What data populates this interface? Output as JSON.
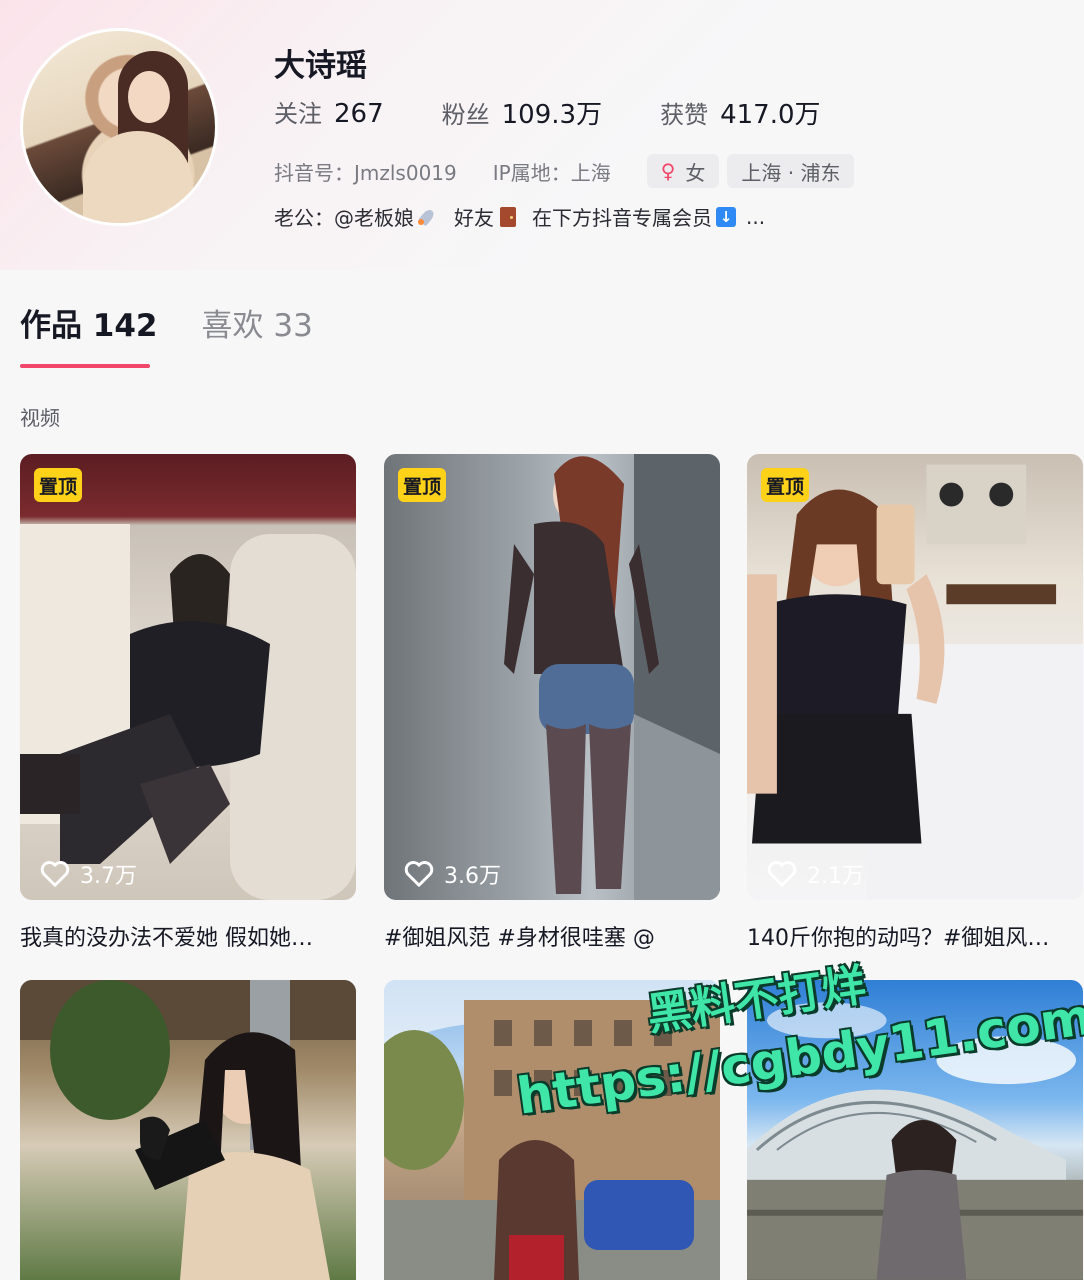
{
  "profile": {
    "name": "大诗瑶",
    "stats": [
      {
        "label": "关注",
        "value": "267"
      },
      {
        "label": "粉丝",
        "value": "109.3万"
      },
      {
        "label": "获赞",
        "value": "417.0万"
      }
    ],
    "douyin_id": "抖音号：Jmzls0019",
    "ip_location": "IP属地：上海",
    "gender_chip": "女",
    "location_chip": "上海 · 浦东",
    "bio": {
      "part1": "老公：@老板娘",
      "part2": "好友",
      "part3": "在下方抖音专属会员",
      "ellipsis": "..."
    }
  },
  "tabs": [
    {
      "label": "作品 142",
      "active": true
    },
    {
      "label": "喜欢 33",
      "active": false
    }
  ],
  "section_label": "视频",
  "pin_label": "置顶",
  "videos": [
    {
      "likes": "3.7万",
      "caption": "我真的没办法不爱她 假如她…",
      "pinned": true
    },
    {
      "likes": "3.6万",
      "caption": "#御姐风范 #身材很哇塞 @",
      "pinned": true
    },
    {
      "likes": "2.1万",
      "caption": "140斤你抱的动吗？#御姐风…",
      "pinned": true
    },
    {
      "likes": "",
      "caption": "",
      "pinned": false
    },
    {
      "likes": "",
      "caption": "",
      "pinned": false
    },
    {
      "likes": "",
      "caption": "",
      "pinned": false
    }
  ],
  "watermark": {
    "line1": "黑料不打烊",
    "line2": "https://cgbdy11.com"
  },
  "colors": {
    "accent": "#f0476a",
    "pin": "#ffd21a",
    "watermark": "#3fe6a8"
  }
}
